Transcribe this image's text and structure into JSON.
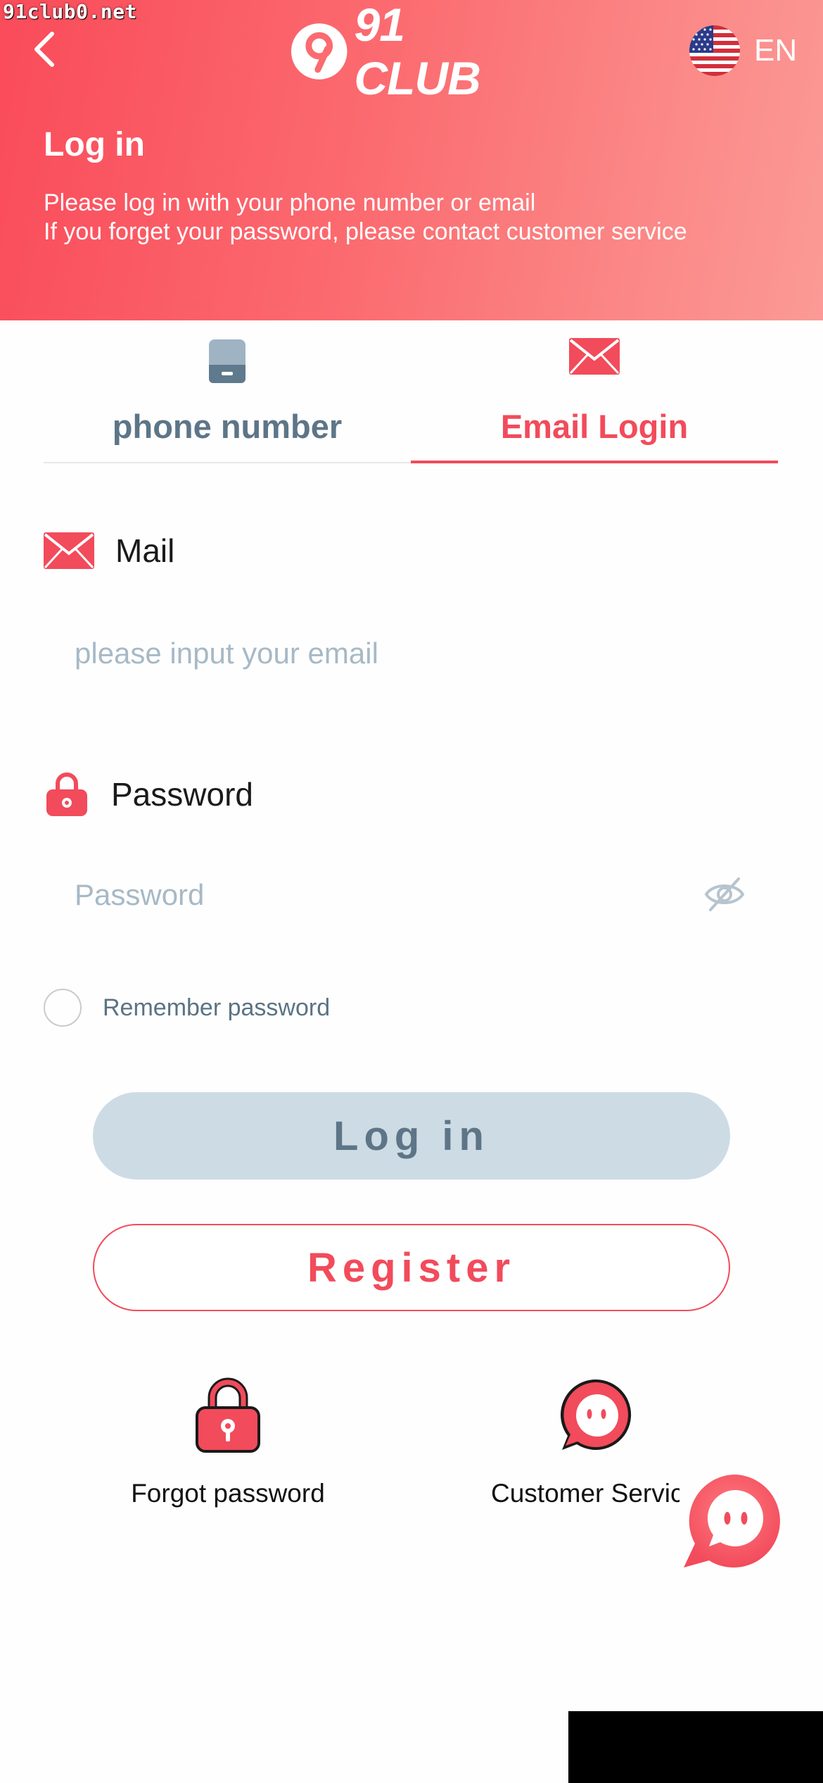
{
  "watermark": "91club0.net",
  "header": {
    "logo_text": "91 CLUB",
    "language": "EN",
    "title": "Log in",
    "desc_line1": "Please log in with your phone number or email",
    "desc_line2": "If you forget your password, please contact customer service",
    "gradient_start": "#fa4b5a",
    "gradient_end": "#fb9a96"
  },
  "tabs": [
    {
      "label": "phone number",
      "icon": "phone-icon",
      "active": false
    },
    {
      "label": "Email Login",
      "icon": "mail-icon",
      "active": true
    }
  ],
  "form": {
    "mail_label": "Mail",
    "mail_placeholder": "please input your email",
    "password_label": "Password",
    "password_placeholder": "Password",
    "remember_label": "Remember password"
  },
  "buttons": {
    "login": "Log in",
    "register": "Register"
  },
  "bottom": {
    "forgot": "Forgot password",
    "customer_service": "Customer Service"
  },
  "colors": {
    "accent": "#f24b5b",
    "muted": "#5d7587",
    "login_bg": "#cddbe4",
    "placeholder": "#a7b9c6"
  }
}
